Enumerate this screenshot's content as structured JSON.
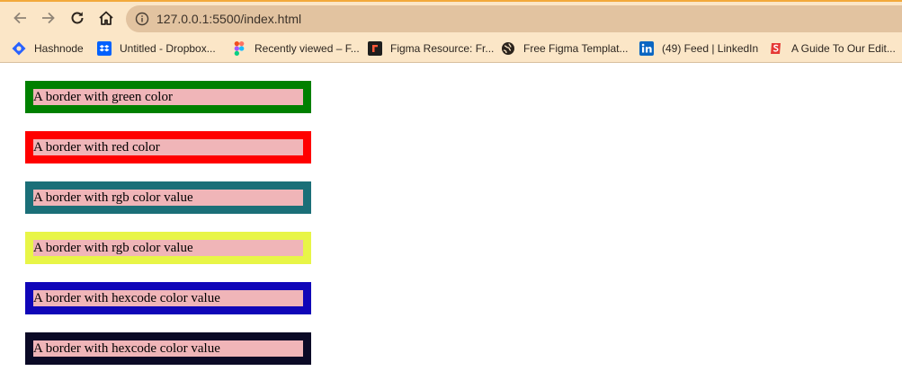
{
  "browser": {
    "url": "127.0.0.1:5500/index.html",
    "bookmarks": [
      {
        "label": "Hashnode",
        "icon": "hashnode-icon"
      },
      {
        "label": "Untitled - Dropbox...",
        "icon": "dropbox-icon"
      },
      {
        "label": "Recently viewed – F...",
        "icon": "figma-icon"
      },
      {
        "label": "Figma Resource: Fr...",
        "icon": "figma-resource-icon"
      },
      {
        "label": "Free Figma Templat...",
        "icon": "globe-icon"
      },
      {
        "label": "(49) Feed | LinkedIn",
        "icon": "linkedin-icon"
      },
      {
        "label": "A Guide To Our Edit...",
        "icon": "smashing-icon"
      }
    ]
  },
  "page": {
    "boxes": [
      {
        "text": "A border with green color",
        "border_color": "#008000"
      },
      {
        "text": "A border with red color",
        "border_color": "#ff0000"
      },
      {
        "text": "A border with rgb color value",
        "border_color": "#1b6f78"
      },
      {
        "text": "A border with rgb color value",
        "border_color": "#e8f547"
      },
      {
        "text": "A border with hexcode color value",
        "border_color": "#1006b8"
      },
      {
        "text": "A border with hexcode color value",
        "border_color": "#0b0a26"
      }
    ],
    "box_background": "#f0b5b8"
  }
}
